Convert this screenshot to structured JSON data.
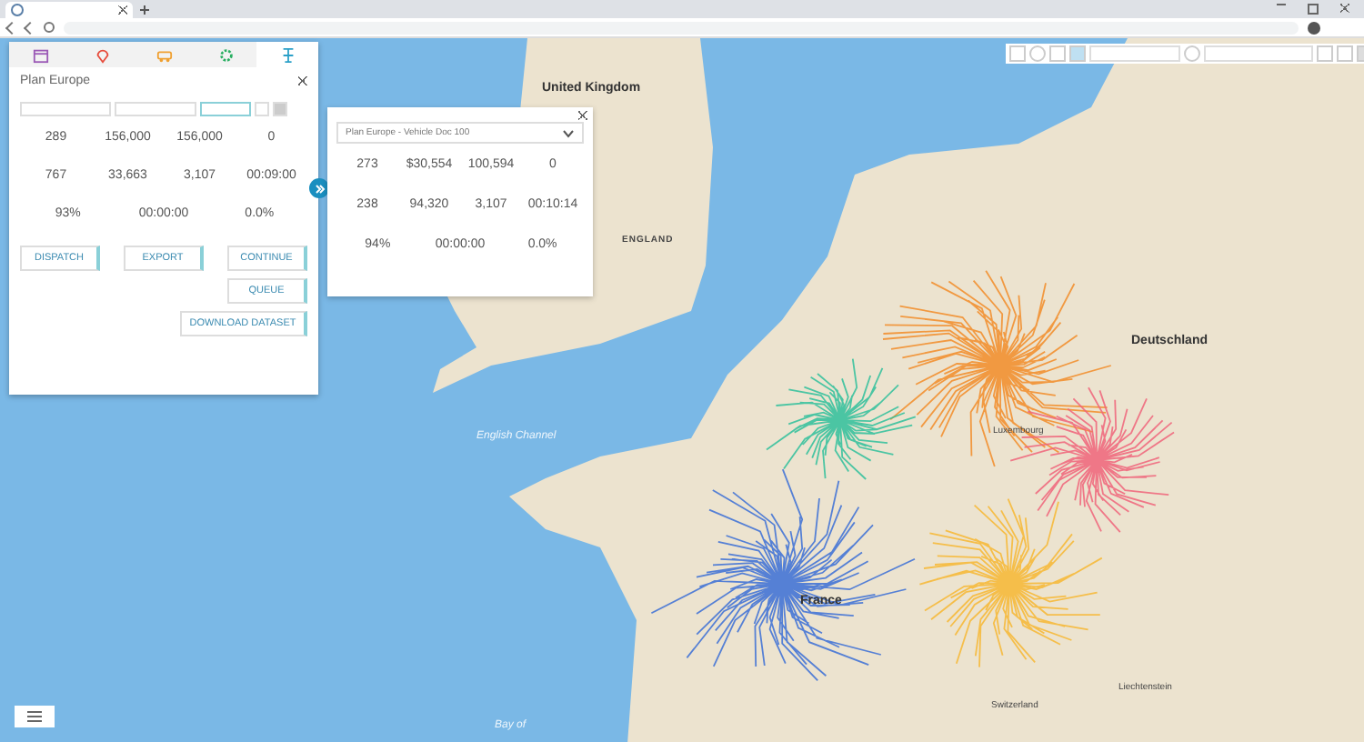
{
  "panel": {
    "tabs": [
      {
        "kind": "calendar",
        "selected": false
      },
      {
        "kind": "pin",
        "selected": false
      },
      {
        "kind": "truck",
        "selected": false
      },
      {
        "kind": "gear",
        "selected": false
      },
      {
        "kind": "route",
        "selected": true
      }
    ],
    "title": "Plan Europe",
    "stats": [
      [
        "289",
        "156,000",
        "156,000",
        "0"
      ],
      [
        "767",
        "33,663",
        "3,107",
        "00:09:00"
      ],
      [
        "93%",
        "00:00:00",
        "0.0%"
      ]
    ],
    "buttons": [
      [
        "DISPATCH",
        "EXPORT",
        "CONTINUE"
      ],
      [
        "QUEUE"
      ],
      [
        "DOWNLOAD DATASET"
      ]
    ]
  },
  "popup": {
    "select": "Plan Europe - Vehicle Doc 100",
    "stats": [
      [
        "273",
        "$30,554",
        "100,594",
        "0"
      ],
      [
        "238",
        "94,320",
        "3,107",
        "00:10:14"
      ],
      [
        "94%",
        "00:00:00",
        "0.0%"
      ]
    ]
  },
  "map_labels": [
    {
      "text": "United Kingdom",
      "kind": "country"
    },
    {
      "text": "ENGLAND",
      "kind": "region"
    },
    {
      "text": "Deutschland",
      "kind": "country"
    },
    {
      "text": "France",
      "kind": "country"
    },
    {
      "text": "English Channel",
      "kind": "sea"
    },
    {
      "text": "Luxembourg",
      "kind": "city"
    },
    {
      "text": "Switzerland",
      "kind": "city"
    },
    {
      "text": "Liechtenstein",
      "kind": "city"
    },
    {
      "text": "Bay of",
      "kind": "sea"
    }
  ]
}
